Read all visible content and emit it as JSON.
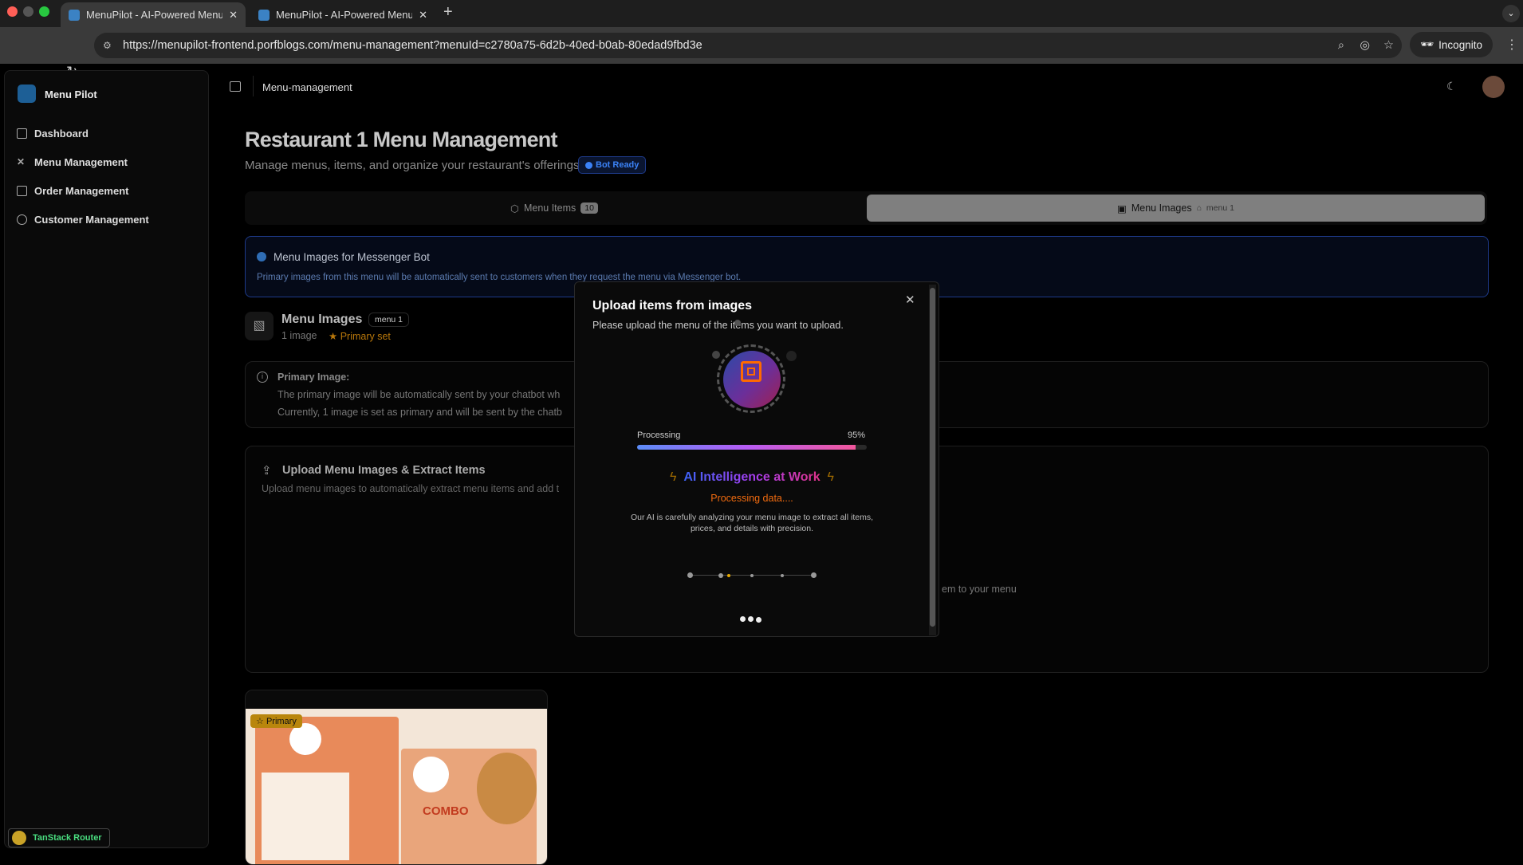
{
  "browser": {
    "tabs": [
      {
        "title": "MenuPilot - AI-Powered Menu Management"
      },
      {
        "title": "MenuPilot - AI-Powered Menu Management"
      }
    ],
    "url": "https://menupilot-frontend.porfblogs.com/menu-management?menuId=c2780a75-6d2b-40ed-b0ab-80edad9fbd3e",
    "incognito": "Incognito"
  },
  "sidebar": {
    "brand": "Menu Pilot",
    "items": [
      {
        "label": "Dashboard",
        "icon": "grid-icon"
      },
      {
        "label": "Menu Management",
        "icon": "utensils-icon"
      },
      {
        "label": "Order Management",
        "icon": "clipboard-icon"
      },
      {
        "label": "Customer Management",
        "icon": "users-icon"
      }
    ]
  },
  "header": {
    "breadcrumb": "Menu-management"
  },
  "page": {
    "title": "Restaurant 1 Menu Management",
    "subtitle": "Manage menus, items, and organize your restaurant's offerings",
    "bot_status": "Bot Ready",
    "tabs": [
      {
        "label": "Menu Items",
        "badge": "10"
      },
      {
        "label": "Menu Images",
        "badge": "menu 1"
      }
    ],
    "info": {
      "title": "Menu Images for Messenger Bot",
      "text": "Primary images from this menu will be automatically sent to customers when they request the menu via Messenger bot."
    },
    "images_header": {
      "title": "Menu Images",
      "menu_badge": "menu 1",
      "count": "1 image",
      "primary": "Primary set"
    },
    "primary_note": {
      "title": "Primary Image:",
      "line1": "The primary image will be automatically sent by your chatbot wh",
      "line2": "Currently, 1 image is set as primary and will be sent by the chatb"
    },
    "upload": {
      "title": "Upload Menu Images & Extract Items",
      "desc": "Upload menu images to automatically extract menu items and add t",
      "dropzone_tail": "em to your menu"
    },
    "image_card": {
      "badge": "Primary",
      "combo": "COMBO"
    }
  },
  "modal": {
    "title": "Upload items from images",
    "subtitle": "Please upload the menu of the items you want to upload.",
    "progress_label": "Processing",
    "progress_value": 95,
    "progress_text": "95%",
    "headline": "AI Intelligence at Work",
    "status": "Processing data....",
    "desc1": "Our AI is carefully analyzing your menu image to extract all items,",
    "desc2": "prices, and details with precision."
  },
  "devtools": {
    "label": "TanStack Router"
  },
  "colors": {
    "accent_blue": "#3b82f6",
    "orange": "#f97316",
    "amber": "#d97706"
  }
}
